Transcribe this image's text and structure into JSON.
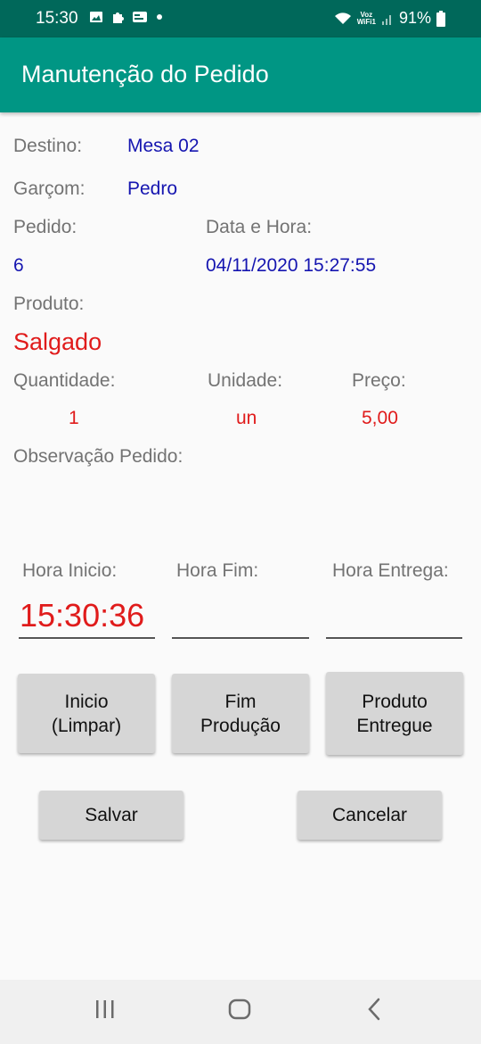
{
  "status_bar": {
    "time": "15:30",
    "voz_label": "Voz",
    "wifi_label": "WiFi1",
    "battery": "91%"
  },
  "app_bar": {
    "title": "Manutenção do Pedido"
  },
  "form": {
    "destino_label": "Destino:",
    "destino_value": "Mesa 02",
    "garcom_label": "Garçom:",
    "garcom_value": "Pedro",
    "pedido_label": "Pedido:",
    "pedido_value": "6",
    "data_hora_label": "Data e Hora:",
    "data_hora_value": "04/11/2020 15:27:55",
    "produto_label": "Produto:",
    "produto_value": "Salgado",
    "quantidade_label": "Quantidade:",
    "quantidade_value": "1",
    "unidade_label": "Unidade:",
    "unidade_value": "un",
    "preco_label": "Preço:",
    "preco_value": "5,00",
    "observacao_label": "Observação Pedido:",
    "hora_inicio_label": "Hora Inicio:",
    "hora_inicio_value": "15:30:36",
    "hora_fim_label": "Hora Fim:",
    "hora_fim_value": "",
    "hora_entrega_label": "Hora Entrega:",
    "hora_entrega_value": ""
  },
  "buttons": {
    "inicio_line1": "Inicio",
    "inicio_line2": "(Limpar)",
    "fim_line1": "Fim",
    "fim_line2": "Produção",
    "entregue_line1": "Produto",
    "entregue_line2": "Entregue",
    "salvar": "Salvar",
    "cancelar": "Cancelar"
  },
  "colors": {
    "status_bar": "#00685a",
    "app_bar": "#009684",
    "value_blue": "#1515b0",
    "value_red": "#e01b1b",
    "button_bg": "#d6d6d6"
  },
  "icons": [
    "image-icon",
    "puzzle-icon",
    "card-icon",
    "dot-icon",
    "wifi-icon",
    "signal-icon",
    "battery-icon",
    "recent-apps-icon",
    "home-icon",
    "back-icon"
  ]
}
